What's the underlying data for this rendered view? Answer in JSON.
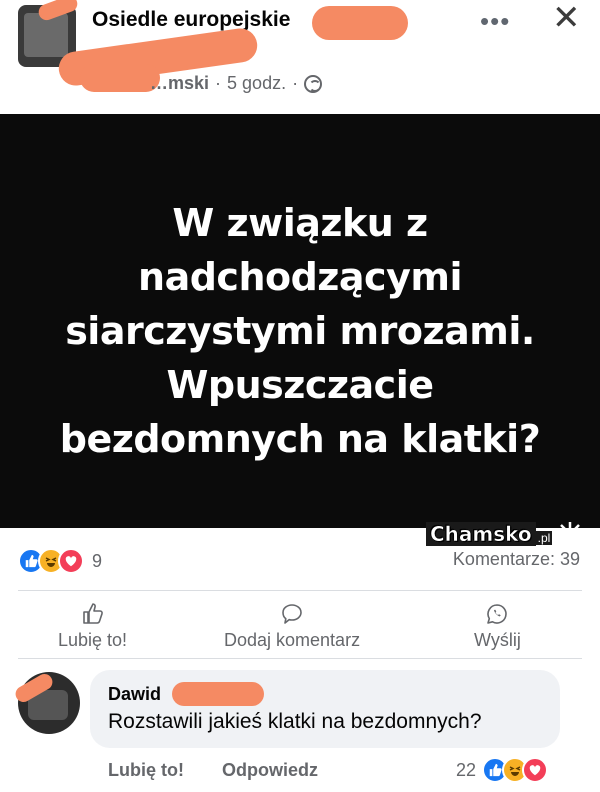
{
  "post": {
    "group_name": "Osiedle europejskie",
    "author": "…mski",
    "time": "5 godz.",
    "separator": "·",
    "more_glyph": "•••",
    "close_glyph": "✕",
    "image_text": "W związku z nadchodzącymi siarczystymi mrozami. Wpuszczacie bezdomnych na klatki?"
  },
  "watermark": {
    "name": "Chamsko",
    "tld": ".pl"
  },
  "reactions": {
    "types": [
      "like-icon",
      "haha-icon",
      "love-icon"
    ],
    "count": "9",
    "comments": "Komentarze: 39"
  },
  "actions": {
    "like": "Lubię to!",
    "comment": "Dodaj komentarz",
    "share": "Wyślij"
  },
  "comment": {
    "author": "Dawid",
    "text": "Rozstawili jakieś klatki na bezdomnych?",
    "like": "Lubię to!",
    "reply": "Odpowiedz",
    "reaction_count": "22"
  },
  "colors": {
    "like": "#1877f2",
    "haha": "#f7b125",
    "love": "#f33e58",
    "redaction": "#f58a63"
  }
}
